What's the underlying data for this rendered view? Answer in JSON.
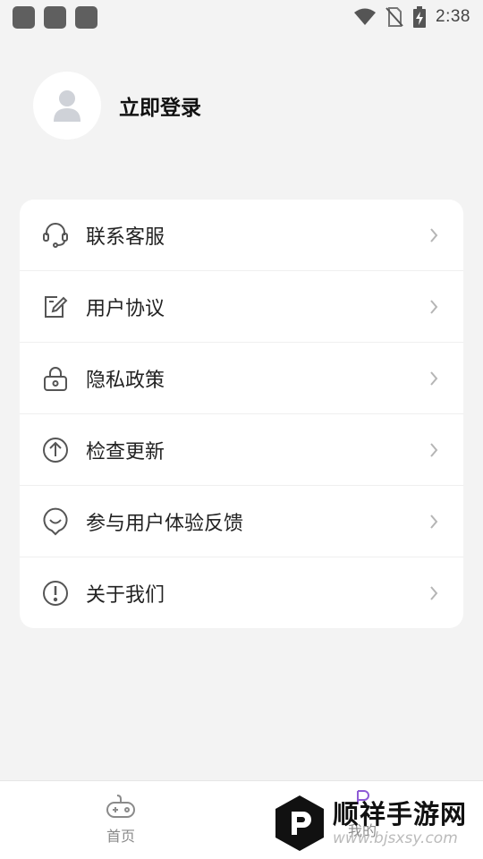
{
  "status_bar": {
    "time": "2:38"
  },
  "profile": {
    "login_label": "立即登录"
  },
  "menu": {
    "items": [
      {
        "label": "联系客服",
        "icon": "headset-icon"
      },
      {
        "label": "用户协议",
        "icon": "edit-document-icon"
      },
      {
        "label": "隐私政策",
        "icon": "lock-icon"
      },
      {
        "label": "检查更新",
        "icon": "arrow-up-circle-icon"
      },
      {
        "label": "参与用户体验反馈",
        "icon": "feedback-smile-icon"
      },
      {
        "label": "关于我们",
        "icon": "info-exclamation-icon"
      }
    ]
  },
  "bottom_nav": {
    "home_label": "首页",
    "mine_label": "我的"
  },
  "watermark": {
    "title": "顺祥手游网",
    "url": "www.bjsxsy.com"
  },
  "colors": {
    "background": "#f3f3f3",
    "card": "#ffffff",
    "icon_gray": "#666666",
    "accent_purple": "#8e5bd6"
  }
}
